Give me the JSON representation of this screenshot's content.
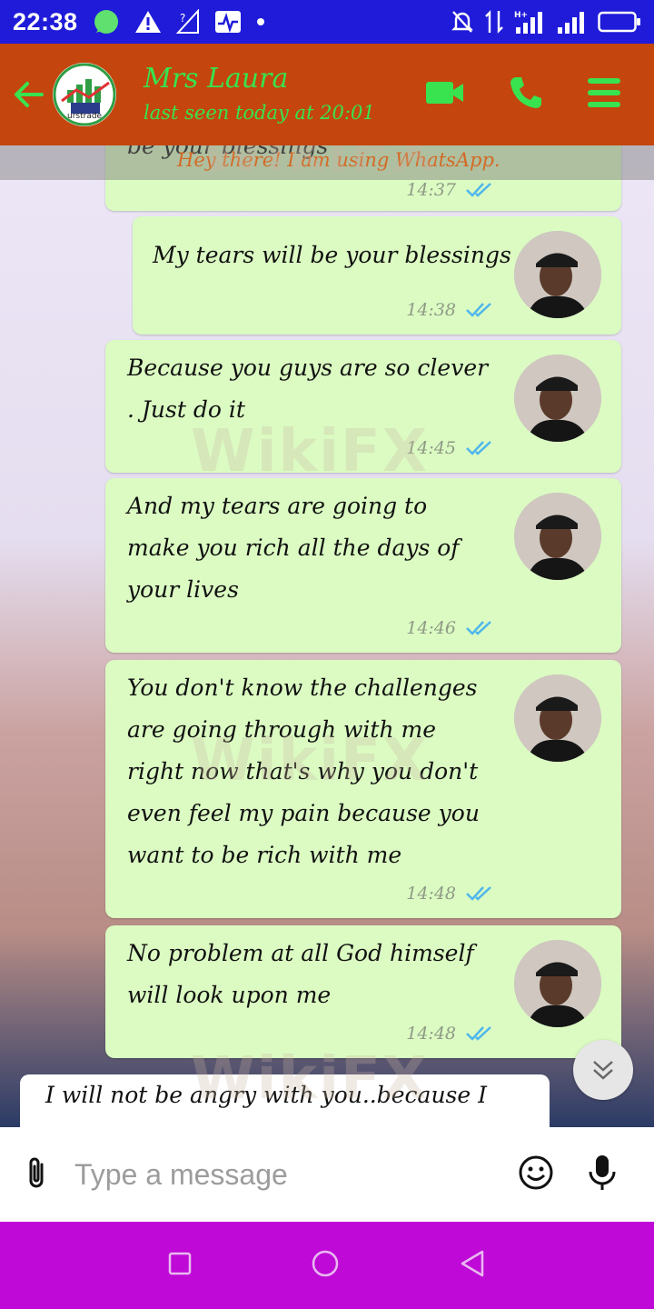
{
  "status_bar": {
    "time": "22:38"
  },
  "header": {
    "contact_name": "Mrs Laura",
    "last_seen": "last seen today at 20:01",
    "status_line": "Hey there! I am using WhatsApp.",
    "logo_text": "urstrade"
  },
  "messages": [
    {
      "text": "be your blessings",
      "time": "14:37"
    },
    {
      "text": "My tears will be your blessings",
      "time": "14:38"
    },
    {
      "text": "Because you guys are so clever . Just do it",
      "time": "14:45"
    },
    {
      "text": "And my tears are going to make you rich all the days of your lives",
      "time": "14:46"
    },
    {
      "text": "You don't know the challenges are going through with me right now that's why you don't even feel my pain because you want to be rich with me",
      "time": "14:48"
    },
    {
      "text": "No problem at all God himself will look upon me",
      "time": "14:48"
    }
  ],
  "incoming_preview": {
    "text": "I will not be angry with you..because I"
  },
  "input": {
    "placeholder": "Type a message"
  },
  "watermark_text": "WikiFX",
  "colors": {
    "header": "#c4450e",
    "accent_green": "#39e24f",
    "status_bar": "#1f1bd9",
    "nav_bar": "#bf0ad7",
    "bubble": "#dbfbc2",
    "tick": "#4fb6ec"
  }
}
